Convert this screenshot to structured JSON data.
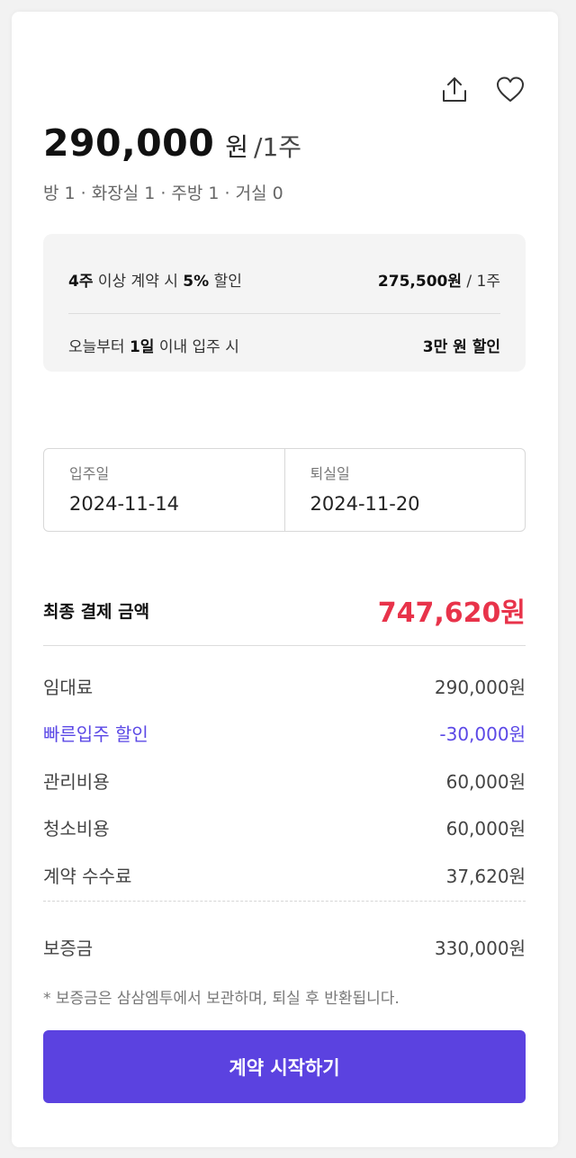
{
  "header": {
    "share_icon": "share-icon",
    "favorite_icon": "heart-icon"
  },
  "price": {
    "amount": "290,000",
    "unit": "원",
    "period": "/1주"
  },
  "room_info": "방 1 · 화장실 1 · 주방 1 · 거실 0",
  "discounts": {
    "row1": {
      "bold1": "4주",
      "text1": " 이상 계약 시 ",
      "bold2": "5%",
      "text2": " 할인",
      "value_bold": "275,500원",
      "value_rest": " / 1주"
    },
    "row2": {
      "text1": "오늘부터 ",
      "bold1": "1일",
      "text2": " 이내 입주 시",
      "value_bold": "3만 원 할인"
    }
  },
  "dates": {
    "checkin_label": "입주일",
    "checkin_value": "2024-11-14",
    "checkout_label": "퇴실일",
    "checkout_value": "2024-11-20"
  },
  "total": {
    "label": "최종 결제 금액",
    "value": "747,620원"
  },
  "fees": [
    {
      "label": "임대료",
      "value": "290,000원"
    },
    {
      "label": "빠른입주 할인",
      "value": "-30,000원"
    },
    {
      "label": "관리비용",
      "value": "60,000원"
    },
    {
      "label": "청소비용",
      "value": "60,000원"
    },
    {
      "label": "계약 수수료",
      "value": "37,620원"
    }
  ],
  "deposit": {
    "label": "보증금",
    "value": "330,000원",
    "note": "* 보증금은 삼삼엠투에서 보관하며, 퇴실 후 반환됩니다."
  },
  "cta_label": "계약 시작하기",
  "colors": {
    "accent": "#5b42e0",
    "total": "#e8334a",
    "discount_text": "#5b48e6"
  }
}
